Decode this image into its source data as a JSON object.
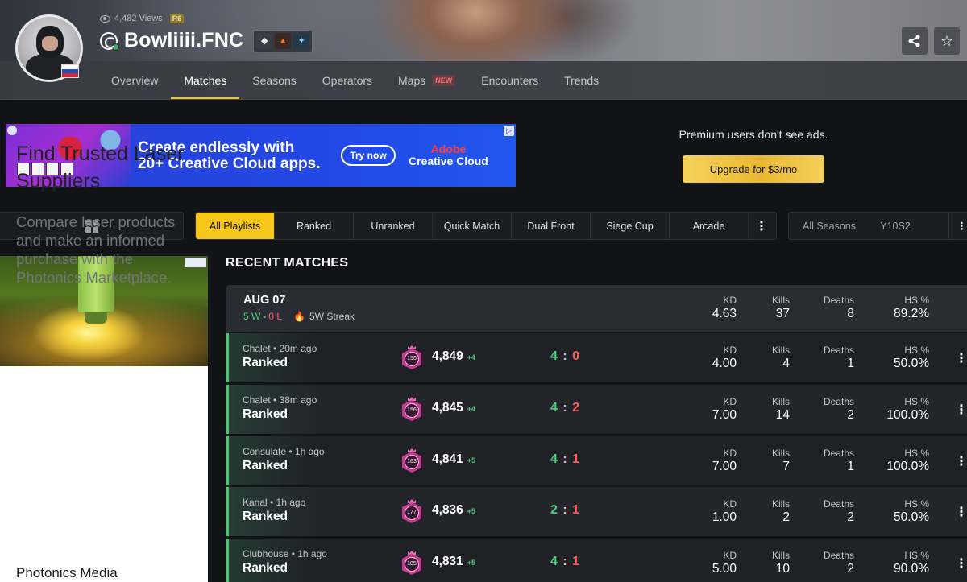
{
  "header": {
    "views": "4,482 Views",
    "game_badge": "R6",
    "player_name": "Bowliiii.FNC",
    "nav": [
      {
        "label": "Overview"
      },
      {
        "label": "Matches"
      },
      {
        "label": "Seasons"
      },
      {
        "label": "Operators"
      },
      {
        "label": "Maps",
        "badge": "NEW"
      },
      {
        "label": "Encounters"
      },
      {
        "label": "Trends"
      }
    ],
    "active_tab": "Matches",
    "share_icon": "share-icon",
    "favorite_icon": "star-icon"
  },
  "ad_banner": {
    "headline_line1": "Create endlessly with",
    "headline_line2": "20+ Creative Cloud apps.",
    "cta": "Try now",
    "brand_line1": "Adobe",
    "brand_line2": "Creative Cloud"
  },
  "premium": {
    "note": "Premium users don't see ads.",
    "button": "Upgrade for $3/mo"
  },
  "filters": {
    "platform_icon": "windows-icon",
    "playlists": [
      "All Playlists",
      "Ranked",
      "Unranked",
      "Quick Match",
      "Dual Front",
      "Siege Cup",
      "Arcade"
    ],
    "active_playlist": "All Playlists",
    "more_icon": "⋮",
    "season_all": "All Seasons",
    "season_value": "Y10S2"
  },
  "side_ad": {
    "title": "Find Trusted Laser Suppliers",
    "description": "Compare laser products and make an informed purchase with the Photonics Marketplace.",
    "brand": "Photonics Media"
  },
  "matches": {
    "title": "RECENT MATCHES",
    "stat_labels": {
      "kd": "KD",
      "kills": "Kills",
      "deaths": "Deaths",
      "hs": "HS %"
    },
    "day": {
      "date": "AUG 07",
      "wins": "5 W",
      "dash": "-",
      "losses": "0 L",
      "streak": "5W Streak",
      "kd": "4.63",
      "kills": "37",
      "deaths": "8",
      "hs": "89.2%"
    },
    "rows": [
      {
        "map": "Chalet • 20m ago",
        "mode": "Ranked",
        "rank_level": "150",
        "rp": "4,849",
        "gain": "+4",
        "score_win": "4",
        "score_loss": "0",
        "kd": "4.00",
        "kills": "4",
        "deaths": "1",
        "hs": "50.0%"
      },
      {
        "map": "Chalet • 38m ago",
        "mode": "Ranked",
        "rank_level": "156",
        "rp": "4,845",
        "gain": "+4",
        "score_win": "4",
        "score_loss": "2",
        "kd": "7.00",
        "kills": "14",
        "deaths": "2",
        "hs": "100.0%"
      },
      {
        "map": "Consulate • 1h ago",
        "mode": "Ranked",
        "rank_level": "163",
        "rp": "4,841",
        "gain": "+5",
        "score_win": "4",
        "score_loss": "1",
        "kd": "7.00",
        "kills": "7",
        "deaths": "1",
        "hs": "100.0%"
      },
      {
        "map": "Kanal • 1h ago",
        "mode": "Ranked",
        "rank_level": "177",
        "rp": "4,836",
        "gain": "+5",
        "score_win": "2",
        "score_loss": "1",
        "kd": "1.00",
        "kills": "2",
        "deaths": "2",
        "hs": "50.0%"
      },
      {
        "map": "Clubhouse • 1h ago",
        "mode": "Ranked",
        "rank_level": "185",
        "rp": "4,831",
        "gain": "+5",
        "score_win": "4",
        "score_loss": "1",
        "kd": "5.00",
        "kills": "10",
        "deaths": "2",
        "hs": "90.0%"
      }
    ]
  },
  "colors": {
    "accent": "#f5c518",
    "win": "#4cd07b",
    "loss": "#ff5a5a",
    "rank_pink": "#c43b8f"
  }
}
